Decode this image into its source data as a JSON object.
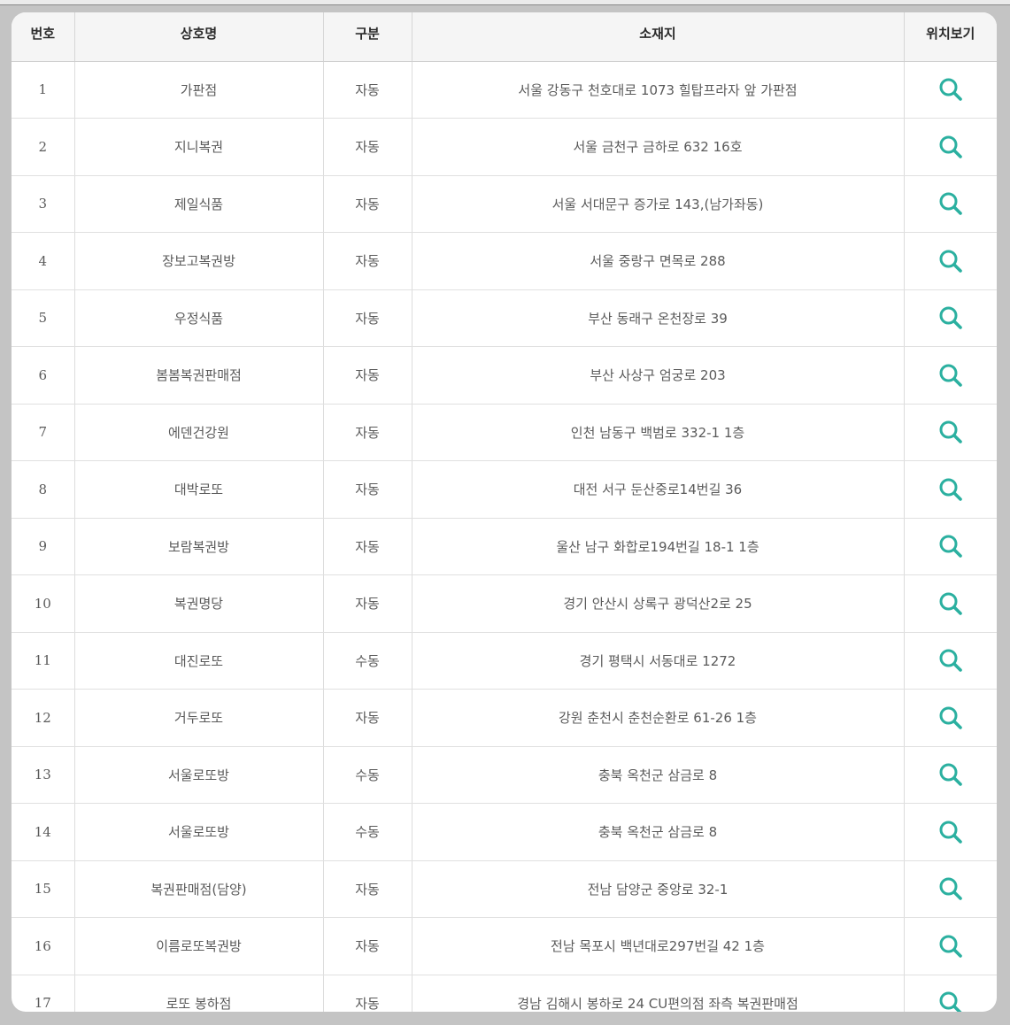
{
  "table": {
    "headers": {
      "number": "번호",
      "name": "상호명",
      "type": "구분",
      "address": "소재지",
      "location": "위치보기"
    },
    "icon": "search-icon",
    "accent_color": "#2bb0a0",
    "rows": [
      {
        "number": "1",
        "name": "가판점",
        "type": "자동",
        "address": "서울 강동구 천호대로 1073 힐탑프라자 앞 가판점"
      },
      {
        "number": "2",
        "name": "지니복권",
        "type": "자동",
        "address": "서울 금천구 금하로 632 16호"
      },
      {
        "number": "3",
        "name": "제일식품",
        "type": "자동",
        "address": "서울 서대문구 증가로 143,(남가좌동)"
      },
      {
        "number": "4",
        "name": "장보고복권방",
        "type": "자동",
        "address": "서울 중랑구 면목로 288"
      },
      {
        "number": "5",
        "name": "우정식품",
        "type": "자동",
        "address": "부산 동래구 온천장로 39"
      },
      {
        "number": "6",
        "name": "봄봄복권판매점",
        "type": "자동",
        "address": "부산 사상구 엄궁로 203"
      },
      {
        "number": "7",
        "name": "에덴건강원",
        "type": "자동",
        "address": "인천 남동구 백범로 332-1 1층"
      },
      {
        "number": "8",
        "name": "대박로또",
        "type": "자동",
        "address": "대전 서구 둔산중로14번길 36"
      },
      {
        "number": "9",
        "name": "보람복권방",
        "type": "자동",
        "address": "울산 남구 화합로194번길 18-1 1층"
      },
      {
        "number": "10",
        "name": "복권명당",
        "type": "자동",
        "address": "경기 안산시 상록구 광덕산2로 25"
      },
      {
        "number": "11",
        "name": "대진로또",
        "type": "수동",
        "address": "경기 평택시 서동대로 1272"
      },
      {
        "number": "12",
        "name": "거두로또",
        "type": "자동",
        "address": "강원 춘천시 춘천순환로 61-26 1층"
      },
      {
        "number": "13",
        "name": "서울로또방",
        "type": "수동",
        "address": "충북 옥천군 삼금로 8"
      },
      {
        "number": "14",
        "name": "서울로또방",
        "type": "수동",
        "address": "충북 옥천군 삼금로 8"
      },
      {
        "number": "15",
        "name": "복권판매점(담양)",
        "type": "자동",
        "address": "전남 담양군 중앙로 32-1"
      },
      {
        "number": "16",
        "name": "이름로또복권방",
        "type": "자동",
        "address": "전남 목포시 백년대로297번길 42 1층"
      },
      {
        "number": "17",
        "name": "로또 봉하점",
        "type": "자동",
        "address": "경남 김해시 봉하로 24 CU편의점 좌측 복권판매점"
      }
    ]
  }
}
